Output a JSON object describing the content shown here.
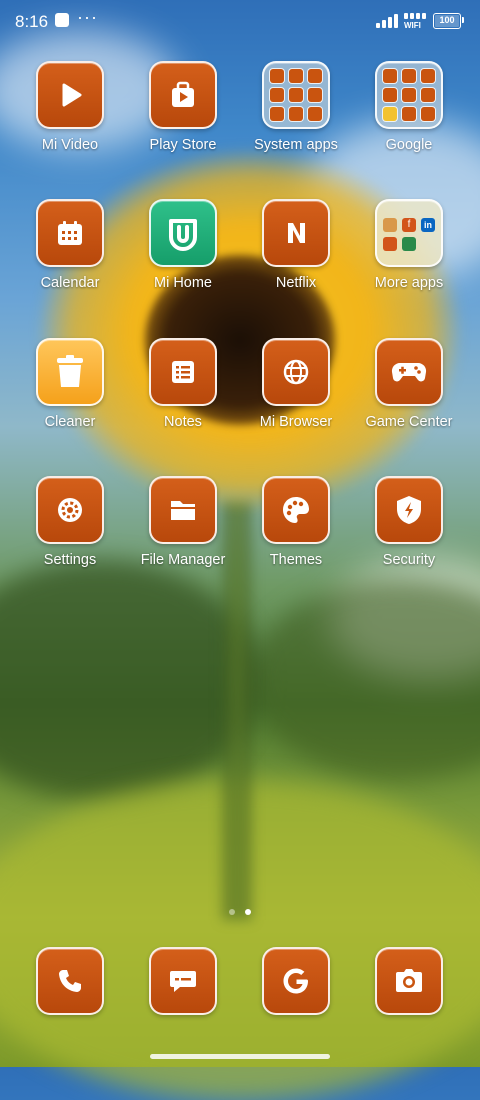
{
  "status_bar": {
    "time": "8:16",
    "overflow": "···",
    "wifi_label": "WIFI",
    "battery": "100"
  },
  "apps": [
    {
      "label": "Mi Video",
      "icon": "play-icon"
    },
    {
      "label": "Play Store",
      "icon": "play-store-icon"
    },
    {
      "label": "System apps",
      "icon": "folder-icon"
    },
    {
      "label": "Google",
      "icon": "folder-icon"
    },
    {
      "label": "Calendar",
      "icon": "calendar-icon"
    },
    {
      "label": "Mi Home",
      "icon": "mi-home-icon"
    },
    {
      "label": "Netflix",
      "icon": "netflix-icon"
    },
    {
      "label": "More apps",
      "icon": "folder-icon"
    },
    {
      "label": "Cleaner",
      "icon": "trash-icon"
    },
    {
      "label": "Notes",
      "icon": "notes-icon"
    },
    {
      "label": "Mi Browser",
      "icon": "globe-icon"
    },
    {
      "label": "Game Center",
      "icon": "gamepad-icon"
    },
    {
      "label": "Settings",
      "icon": "gear-icon"
    },
    {
      "label": "File Manager",
      "icon": "file-folder-icon"
    },
    {
      "label": "Themes",
      "icon": "palette-icon"
    },
    {
      "label": "Security",
      "icon": "shield-icon"
    }
  ],
  "dock": [
    {
      "name": "Phone",
      "icon": "phone-icon"
    },
    {
      "name": "Messages",
      "icon": "message-icon"
    },
    {
      "name": "Google",
      "icon": "google-g-icon"
    },
    {
      "name": "Camera",
      "icon": "camera-icon"
    }
  ],
  "pager": {
    "pages": 2,
    "current": 2
  },
  "colors": {
    "icon_orange": "#c9540f",
    "mi_home_green": "#1fb07a",
    "cleaner_yellow": "#f5a11b"
  },
  "folder_more_apps_glyphs": {
    "f": "f",
    "in": "in"
  }
}
